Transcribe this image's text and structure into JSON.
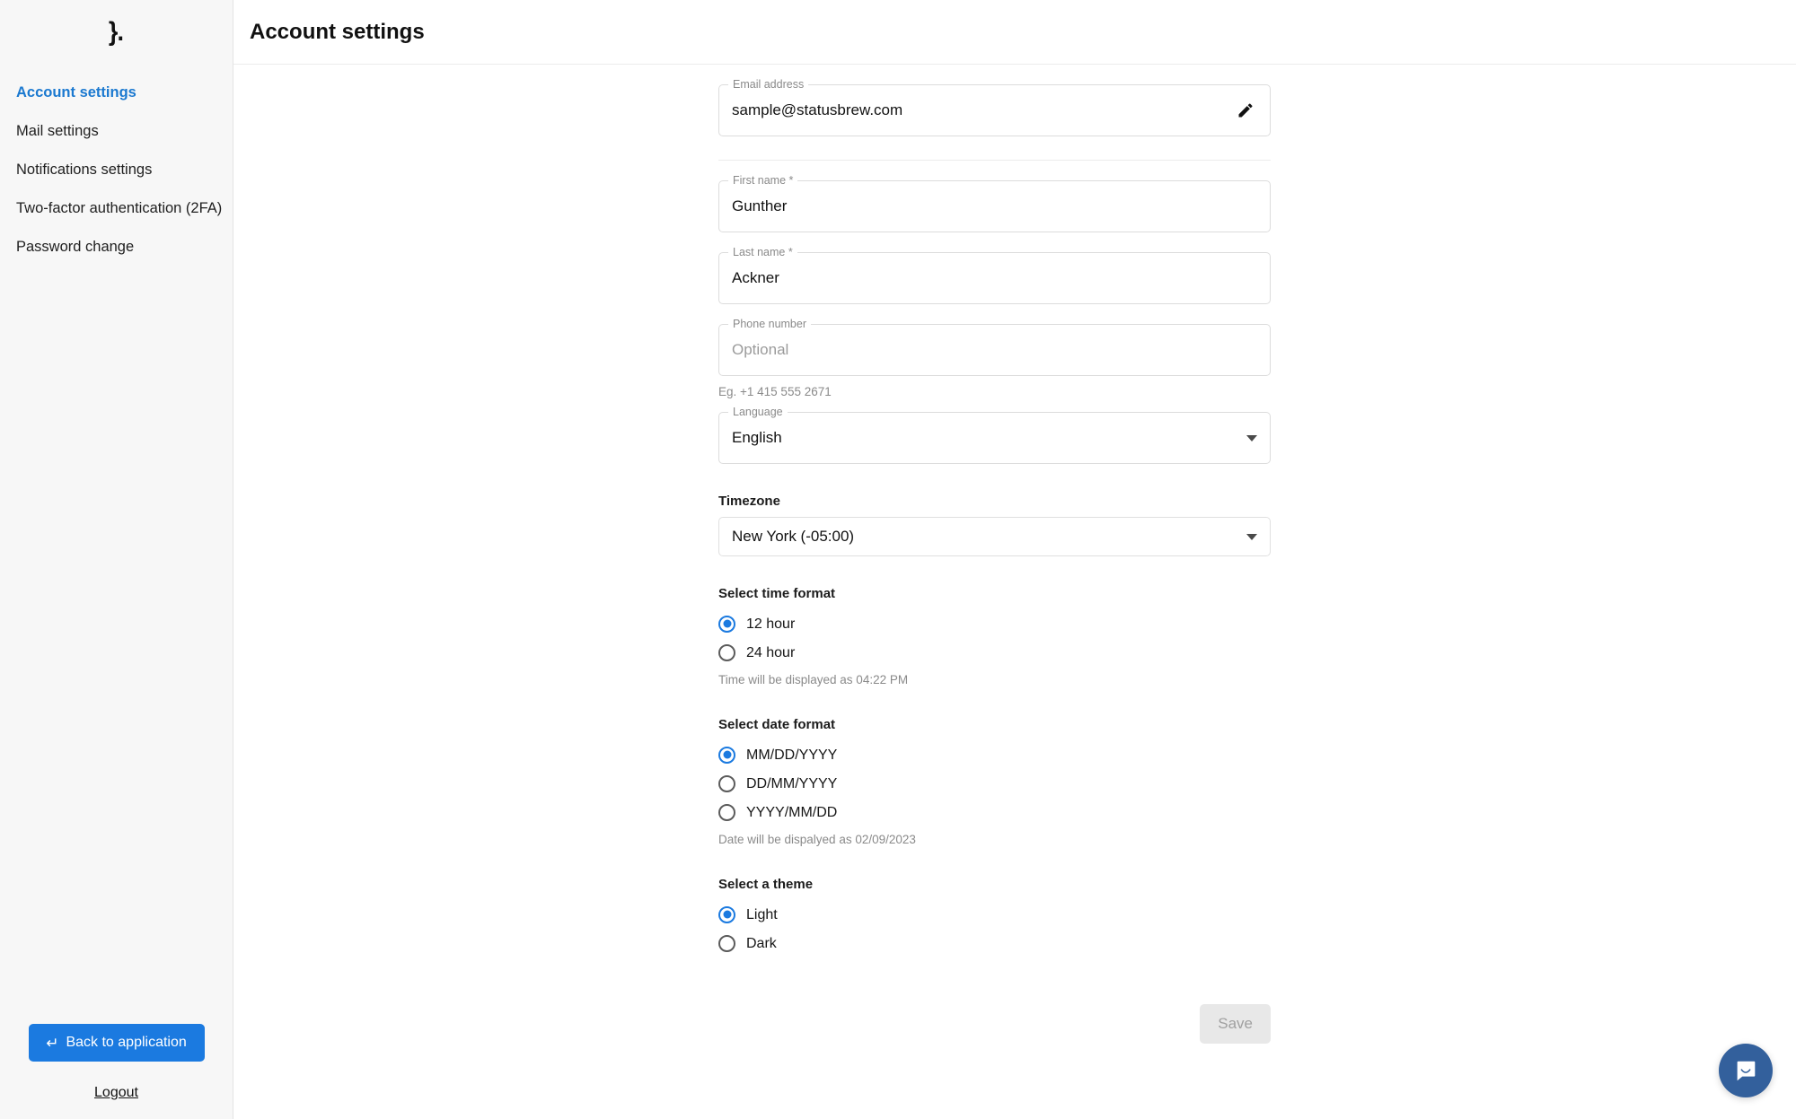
{
  "sidebar": {
    "logo_glyph": "}.",
    "logo_name": "statusbrew-logo",
    "items": [
      {
        "label": "Account settings",
        "active": true
      },
      {
        "label": "Mail settings",
        "active": false
      },
      {
        "label": "Notifications settings",
        "active": false
      },
      {
        "label": "Two-factor authentication (2FA)",
        "active": false
      },
      {
        "label": "Password change",
        "active": false
      }
    ],
    "back_button": {
      "label": "Back to application",
      "icon": "return-arrow-icon",
      "glyph": "↵"
    },
    "logout_label": "Logout"
  },
  "header": {
    "title": "Account settings"
  },
  "form": {
    "email": {
      "label": "Email address",
      "value": "sample@statusbrew.com",
      "edit_icon": "pencil-icon"
    },
    "first_name": {
      "label": "First name *",
      "value": "Gunther"
    },
    "last_name": {
      "label": "Last name *",
      "value": "Ackner"
    },
    "phone": {
      "label": "Phone number",
      "value": "",
      "placeholder": "Optional",
      "helper": "Eg. +1 415 555 2671"
    },
    "language": {
      "label": "Language",
      "value": "English",
      "icon": "chevron-down-icon"
    },
    "timezone": {
      "label": "Timezone",
      "value": "New York (-05:00)",
      "icon": "chevron-down-icon"
    },
    "time_format": {
      "label": "Select time format",
      "options": [
        {
          "label": "12 hour",
          "checked": true
        },
        {
          "label": "24 hour",
          "checked": false
        }
      ],
      "helper": "Time will be displayed as 04:22 PM"
    },
    "date_format": {
      "label": "Select date format",
      "options": [
        {
          "label": "MM/DD/YYYY",
          "checked": true
        },
        {
          "label": "DD/MM/YYYY",
          "checked": false
        },
        {
          "label": "YYYY/MM/DD",
          "checked": false
        }
      ],
      "helper": "Date will be dispalyed as 02/09/2023"
    },
    "theme": {
      "label": "Select a theme",
      "options": [
        {
          "label": "Light",
          "checked": true
        },
        {
          "label": "Dark",
          "checked": false
        }
      ]
    },
    "save": {
      "label": "Save",
      "disabled": true
    }
  },
  "chat": {
    "icon": "chat-bubble-icon"
  },
  "colors": {
    "accent_blue": "#1b7ae0",
    "active_nav_blue": "#1b79d0",
    "sidebar_bg": "#f7f7f7",
    "chat_blue": "#33609c",
    "disabled_button_bg": "#e8e8e8"
  }
}
